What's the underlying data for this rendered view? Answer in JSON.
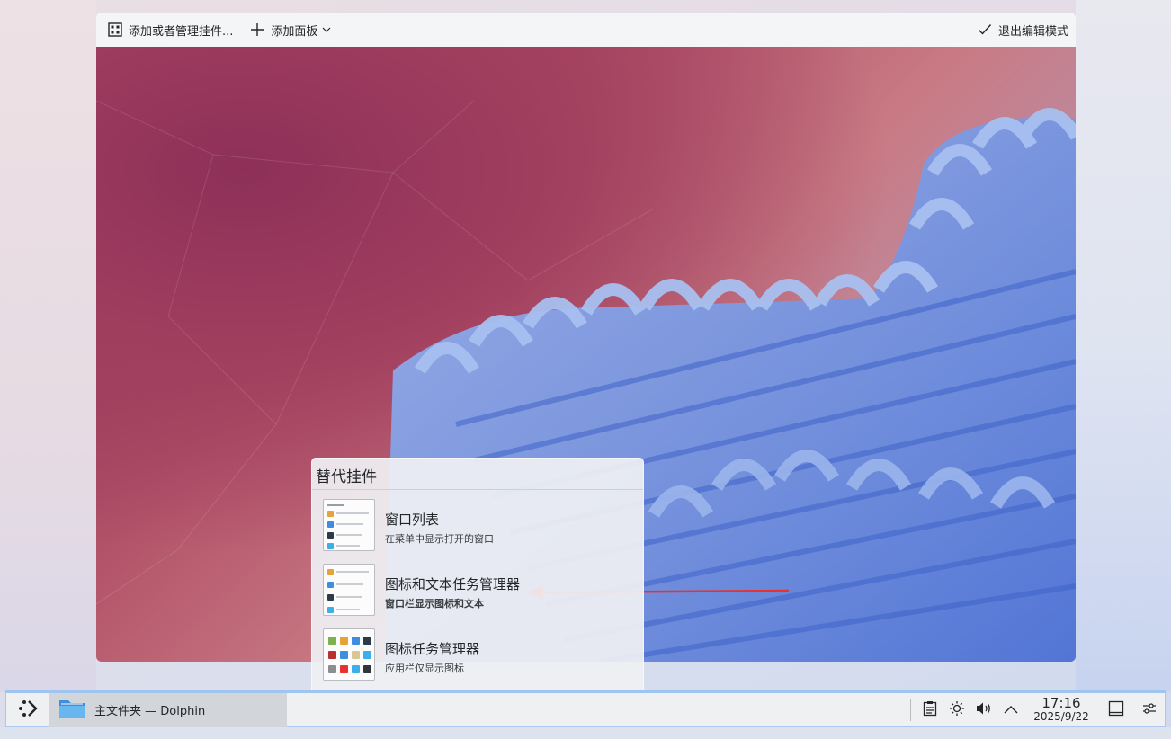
{
  "edit_toolbar": {
    "add_widgets_label": "添加或者管理挂件...",
    "add_panel_label": "添加面板",
    "exit_edit_label": "退出编辑模式"
  },
  "alternatives": {
    "title": "替代挂件",
    "items": [
      {
        "name": "窗口列表",
        "description": "在菜单中显示打开的窗口"
      },
      {
        "name": "图标和文本任务管理器",
        "description": "窗口栏显示图标和文本"
      },
      {
        "name": "图标任务管理器",
        "description": "应用栏仅显示图标"
      }
    ]
  },
  "taskbar": {
    "task_label": "主文件夹 — Dolphin",
    "clock_time": "17:16",
    "clock_date": "2025/9/22"
  },
  "colors": {
    "accent": "#3daee9",
    "arrow": "#e8322d",
    "ribbon_blue": "#5e86db"
  }
}
